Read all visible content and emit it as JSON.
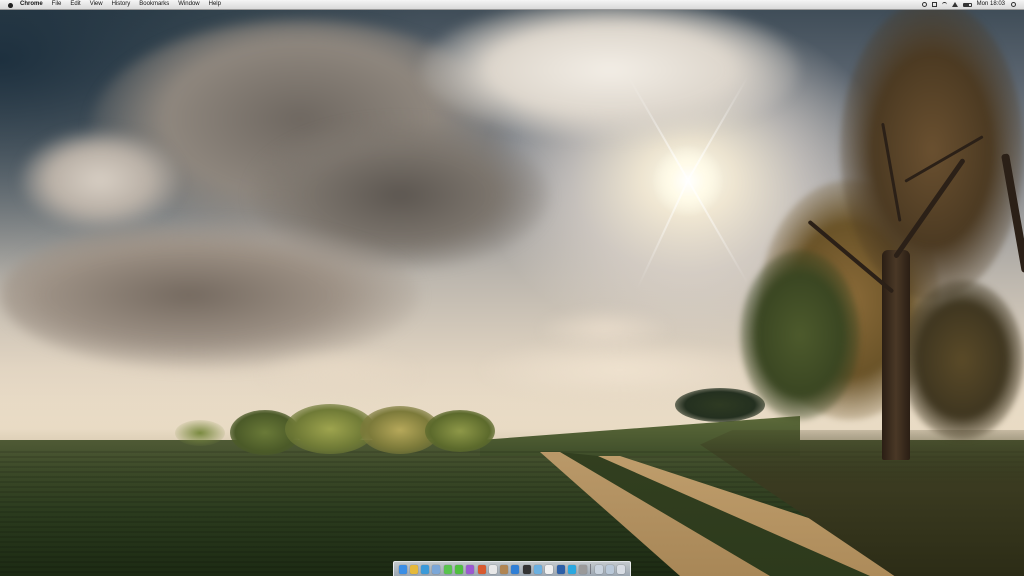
{
  "menubar": {
    "app_name": "Chrome",
    "items": [
      "File",
      "Edit",
      "View",
      "History",
      "Bookmarks",
      "Window",
      "Help"
    ],
    "status_icons": [
      "time-machine-icon",
      "bluetooth-icon",
      "wifi-icon",
      "volume-icon",
      "battery-icon"
    ],
    "clock": "Mon 18:03",
    "spotlight_icon": "spotlight-search-icon"
  },
  "dock": {
    "icons": [
      {
        "name": "finder-icon",
        "color": "#3a8ee6"
      },
      {
        "name": "chrome-icon",
        "color": "#e5b93a"
      },
      {
        "name": "safari-icon",
        "color": "#3b9ad9"
      },
      {
        "name": "mail-icon",
        "color": "#7ba7d8"
      },
      {
        "name": "messages-icon",
        "color": "#59c34e"
      },
      {
        "name": "facetime-icon",
        "color": "#4fbf3f"
      },
      {
        "name": "itunes-icon",
        "color": "#9b59d0"
      },
      {
        "name": "iphoto-icon",
        "color": "#d85a2f"
      },
      {
        "name": "calendar-icon",
        "color": "#e8e8e8"
      },
      {
        "name": "contacts-icon",
        "color": "#b08552"
      },
      {
        "name": "app-store-icon",
        "color": "#2f7fd6"
      },
      {
        "name": "terminal-icon",
        "color": "#333333"
      },
      {
        "name": "preview-icon",
        "color": "#6bb0e0"
      },
      {
        "name": "textedit-icon",
        "color": "#f0f0f0"
      },
      {
        "name": "photoshop-icon",
        "color": "#2c5fa8"
      },
      {
        "name": "skype-icon",
        "color": "#29a8e0"
      },
      {
        "name": "system-preferences-icon",
        "color": "#9a9a9a"
      },
      {
        "name": "documents-stack-icon",
        "color": "#c9d3de"
      },
      {
        "name": "downloads-stack-icon",
        "color": "#b9c8d8"
      },
      {
        "name": "trash-icon",
        "color": "#d8dde4"
      }
    ]
  }
}
